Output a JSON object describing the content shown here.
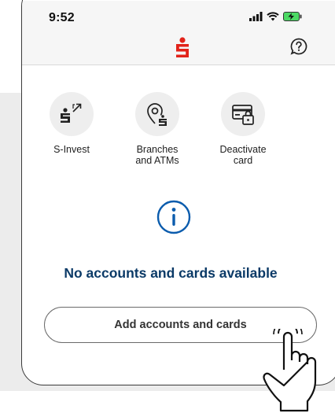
{
  "status": {
    "time": "9:52",
    "icons": [
      "signal-icon",
      "wifi-icon",
      "battery-charging-icon"
    ]
  },
  "appbar": {
    "logo": "sparkasse-logo",
    "help_icon": "help-icon"
  },
  "quick_actions": [
    {
      "label": "S-Invest",
      "icon": "s-invest-icon"
    },
    {
      "label": "Branches\nand ATMs",
      "icon": "location-pin-icon"
    },
    {
      "label": "Deactivate\ncard",
      "icon": "card-lock-icon"
    }
  ],
  "empty_state": {
    "icon": "info-icon",
    "message": "No accounts and cards available"
  },
  "add_button": {
    "label": "Add accounts and cards"
  },
  "colors": {
    "brand_red": "#e2231a",
    "info_blue": "#0b5cad",
    "text_navy": "#0b3a67"
  }
}
